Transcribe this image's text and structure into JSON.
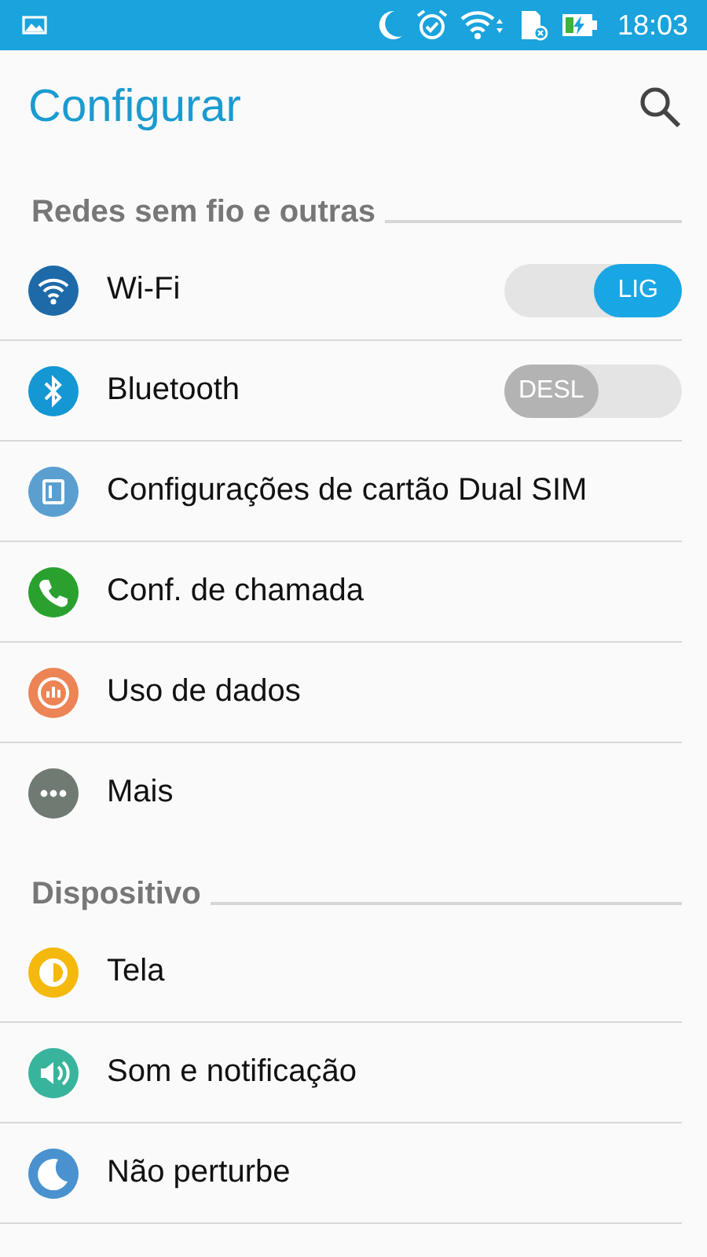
{
  "status_bar": {
    "time": "18:03"
  },
  "header": {
    "title": "Configurar"
  },
  "sections": [
    {
      "title": "Redes sem fio e outras",
      "items": [
        {
          "kind": "toggle",
          "label": "Wi-Fi",
          "color": "#1e6aa8",
          "on": true,
          "switch_text": "LIG"
        },
        {
          "kind": "toggle",
          "label": "Bluetooth",
          "color": "#1497d2",
          "on": false,
          "switch_text": "DESL"
        },
        {
          "kind": "plain",
          "label": "Configurações de cartão Dual SIM",
          "color": "#5b9fd0"
        },
        {
          "kind": "plain",
          "label": "Conf. de chamada",
          "color": "#2aa12f"
        },
        {
          "kind": "plain",
          "label": "Uso de dados",
          "color": "#ec8455"
        },
        {
          "kind": "plain",
          "label": "Mais",
          "color": "#6f7a73"
        }
      ]
    },
    {
      "title": "Dispositivo",
      "items": [
        {
          "kind": "plain",
          "label": "Tela",
          "color": "#f5b80c"
        },
        {
          "kind": "plain",
          "label": "Som e notificação",
          "color": "#39b49c"
        },
        {
          "kind": "plain",
          "label": "Não perturbe",
          "color": "#4a92cf"
        }
      ]
    }
  ]
}
